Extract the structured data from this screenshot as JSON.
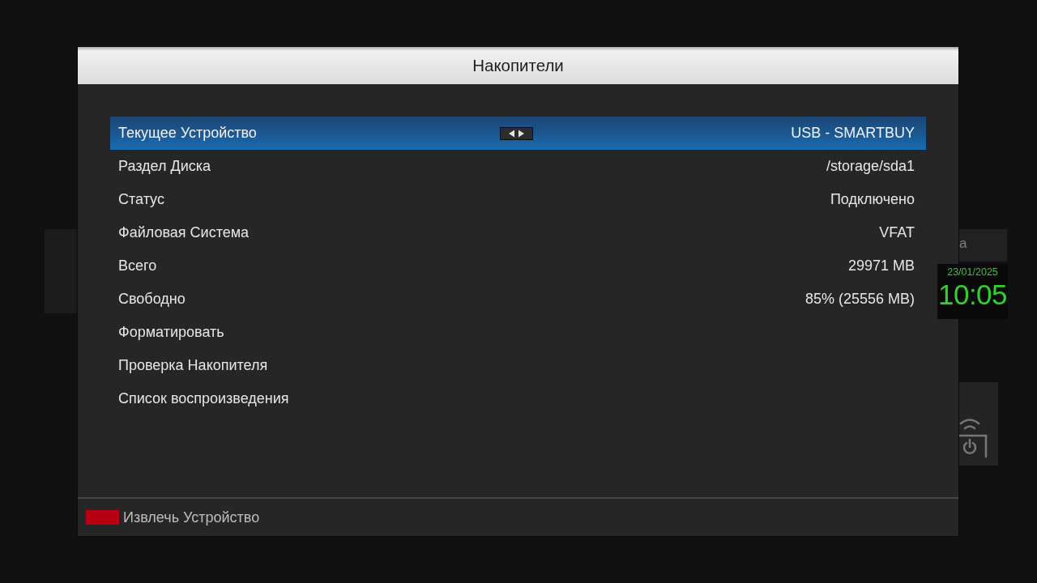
{
  "dialog": {
    "title": "Накопители",
    "rows": [
      {
        "label": "Текущее Устройство",
        "value": "USB - SMARTBUY",
        "selected": true
      },
      {
        "label": "Раздел Диска",
        "value": "/storage/sda1",
        "selected": false
      },
      {
        "label": "Статус",
        "value": "Подключено",
        "selected": false
      },
      {
        "label": "Файловая Система",
        "value": "VFAT",
        "selected": false
      },
      {
        "label": "Всего",
        "value": "29971 MB",
        "selected": false
      },
      {
        "label": "Свободно",
        "value": "85% (25556 MB)",
        "selected": false
      },
      {
        "label": "Форматировать",
        "selected": false
      },
      {
        "label": "Проверка Накопителя",
        "selected": false
      },
      {
        "label": "Список воспроизведения",
        "selected": false
      }
    ],
    "footer_keys": [
      {
        "label": "Извлечь Устройство",
        "color": "#b80012"
      }
    ]
  },
  "clock": {
    "date": "23/01/2025",
    "time": "10:05"
  },
  "background": {
    "panel_label": "а"
  }
}
